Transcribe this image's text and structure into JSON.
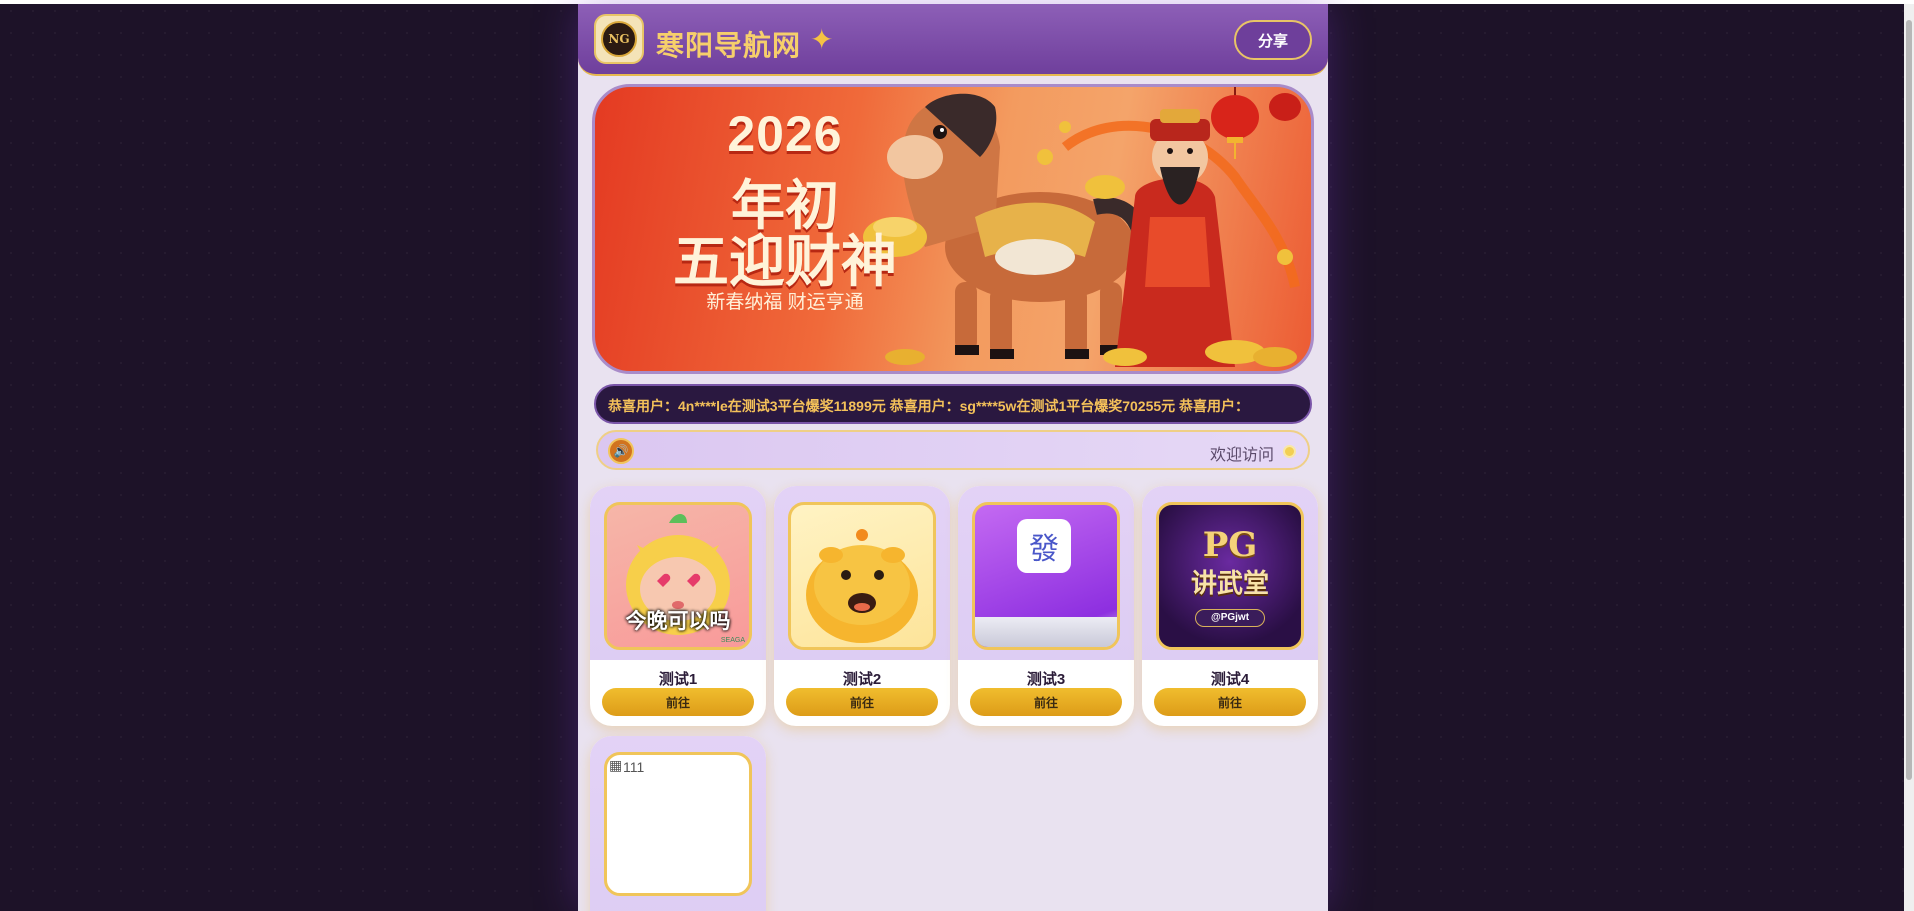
{
  "header": {
    "logo_text": "NG",
    "title": "寒阳导航网",
    "title_sparkle": "✦",
    "share_label": "分享"
  },
  "banner": {
    "line1": "2026",
    "line2": "年初",
    "line3": "五迎财神",
    "subtitle": "新春纳福 财运亨通"
  },
  "ticker": {
    "text": "恭喜用户：4n****le在测试3平台爆奖11899元  恭喜用户：sg****5w在测试1平台爆奖70255元  恭喜用户："
  },
  "notice": {
    "speaker_icon": "speaker-icon",
    "text": "欢迎访问"
  },
  "cards": [
    {
      "name": "测试1",
      "button": "前往",
      "thumb_caption": "今晚可以吗",
      "thumb_tag": "SEAGA"
    },
    {
      "name": "测试2",
      "button": "前往"
    },
    {
      "name": "测试3",
      "button": "前往",
      "thumb_glyph": "發"
    },
    {
      "name": "测试4",
      "button": "前往",
      "thumb_badge": "PG",
      "thumb_title": "讲武堂",
      "thumb_handle": "@PGjwt"
    }
  ],
  "broken_card": {
    "alt": "111"
  },
  "colors": {
    "page_bg": "#1d1228",
    "header_bg": "#7a4aa6",
    "gold": "#f0c55a",
    "ticker_text": "#f4c15a"
  }
}
